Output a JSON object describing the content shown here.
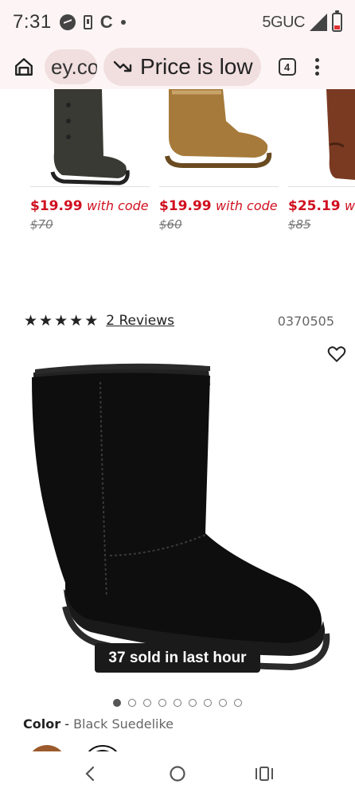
{
  "status_bar": {
    "time": "7:31",
    "network": "5GUC"
  },
  "browser": {
    "url_fragment": "ey.co",
    "price_chip_label": "Price is low",
    "tab_count": "4"
  },
  "recommendations": [
    {
      "price": "$19.99",
      "promo": "with code",
      "original_price": "$70",
      "image_color": "#3a3a34"
    },
    {
      "price": "$19.99",
      "promo": "with code",
      "original_price": "$60",
      "image_color": "#a67a3a"
    },
    {
      "price": "$25.19",
      "promo": "with code",
      "original_price": "$85",
      "image_color": "#7a3a22"
    }
  ],
  "product": {
    "rating": 5,
    "reviews_label": "2 Reviews",
    "sku": "0370505",
    "sold_badge": "37 sold in last hour",
    "image_count": 9,
    "active_image_index": 0,
    "color_label": "Color",
    "color_separator": " - ",
    "color_value": "Black Suedelike",
    "swatches": [
      "brown",
      "black"
    ]
  },
  "icons": {
    "home": "home-icon",
    "trend": "trending-down-icon",
    "tabs": "tabs-icon",
    "menu": "more-vert-icon",
    "wishlist": "heart-icon",
    "back": "back-icon",
    "home_nav": "home-circle-icon",
    "recents": "recents-icon"
  },
  "colors": {
    "sale_red": "#d01020",
    "chrome_bg": "#fdf5f5",
    "chip_bg": "#f1dede"
  }
}
